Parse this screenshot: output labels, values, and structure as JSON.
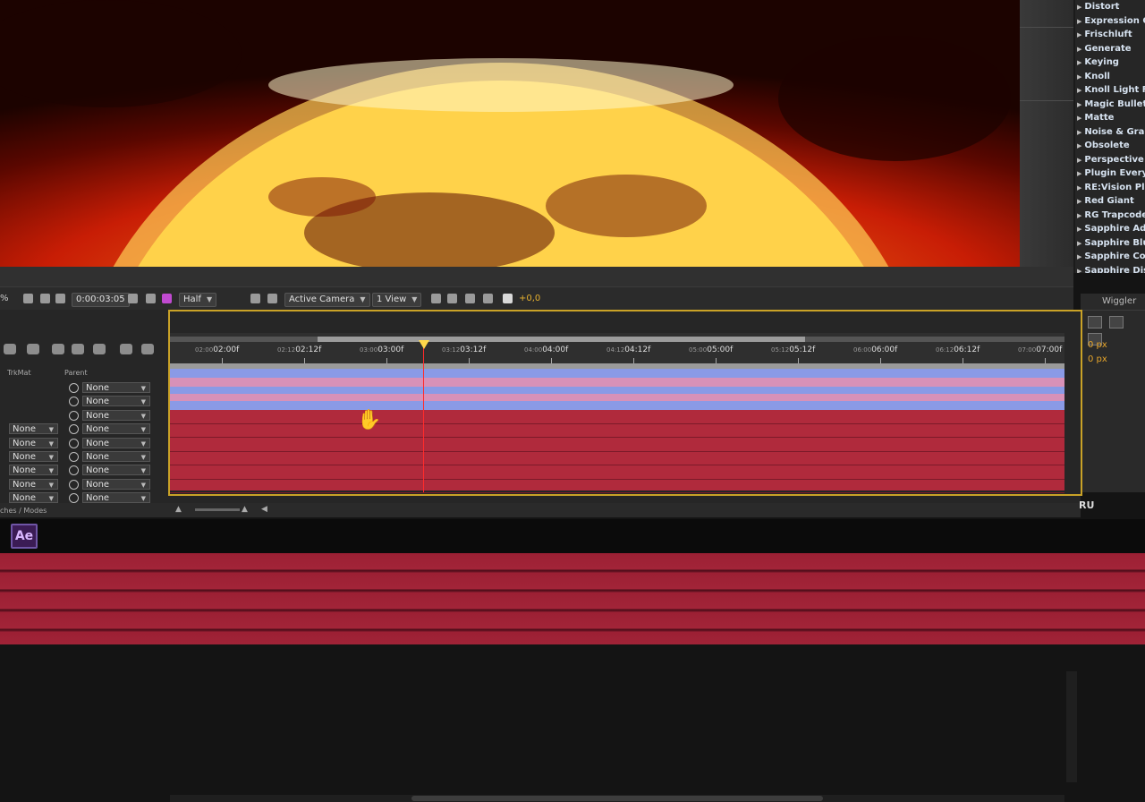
{
  "effects_panel": {
    "items": [
      "Distort",
      "Expression Controls",
      "Frischluft",
      "Generate",
      "Keying",
      "Knoll",
      "Knoll Light Factory",
      "Magic Bullet",
      "Matte",
      "Noise & Grain",
      "Obsolete",
      "Perspective",
      "Plugin Everything",
      "RE:Vision Plug-ins",
      "Red Giant",
      "RG Trapcode",
      "Sapphire Adjust",
      "Sapphire Blur+Sharpen",
      "Sapphire Composite",
      "Sapphire Distort"
    ]
  },
  "viewer_toolbar": {
    "zoom_fragment": "%",
    "timecode": "0:00:03:05",
    "resolution": "Half",
    "camera": "Active Camera",
    "views": "1 View",
    "exposure": "+0,0"
  },
  "wiggler": {
    "title": "Wiggler",
    "value1": "0 px",
    "value2": "0 px"
  },
  "timeline": {
    "col_trkmat": "TrkMat",
    "col_parent": "Parent",
    "ruler": [
      {
        "small": "02:00",
        "big": "02:00f"
      },
      {
        "small": "02:12",
        "big": "02:12f"
      },
      {
        "small": "03:00",
        "big": "03:00f"
      },
      {
        "small": "03:12",
        "big": "03:12f"
      },
      {
        "small": "04:00",
        "big": "04:00f"
      },
      {
        "small": "04:12",
        "big": "04:12f"
      },
      {
        "small": "05:00",
        "big": "05:00f"
      },
      {
        "small": "05:12",
        "big": "05:12f"
      },
      {
        "small": "06:00",
        "big": "06:00f"
      },
      {
        "small": "06:12",
        "big": "06:12f"
      },
      {
        "small": "07:00",
        "big": "07:00f"
      }
    ],
    "layers": [
      {
        "trkmat": "",
        "parent": "None"
      },
      {
        "trkmat": "",
        "parent": "None"
      },
      {
        "trkmat": "",
        "parent": "None"
      },
      {
        "trkmat": "None",
        "parent": "None"
      },
      {
        "trkmat": "None",
        "parent": "None"
      },
      {
        "trkmat": "None",
        "parent": "None"
      },
      {
        "trkmat": "None",
        "parent": "None"
      },
      {
        "trkmat": "None",
        "parent": "None"
      },
      {
        "trkmat": "None",
        "parent": "None"
      }
    ],
    "footer_label": "ches / Modes"
  },
  "taskbar": {
    "app_icon": "Ae",
    "language": "RU"
  },
  "colors": {
    "layer_blue": "#8a9ae6",
    "layer_pink": "#d891b8",
    "layer_red": "#b02a3c",
    "cti": "#ff2b2b",
    "highlight_border": "#c9a227"
  }
}
